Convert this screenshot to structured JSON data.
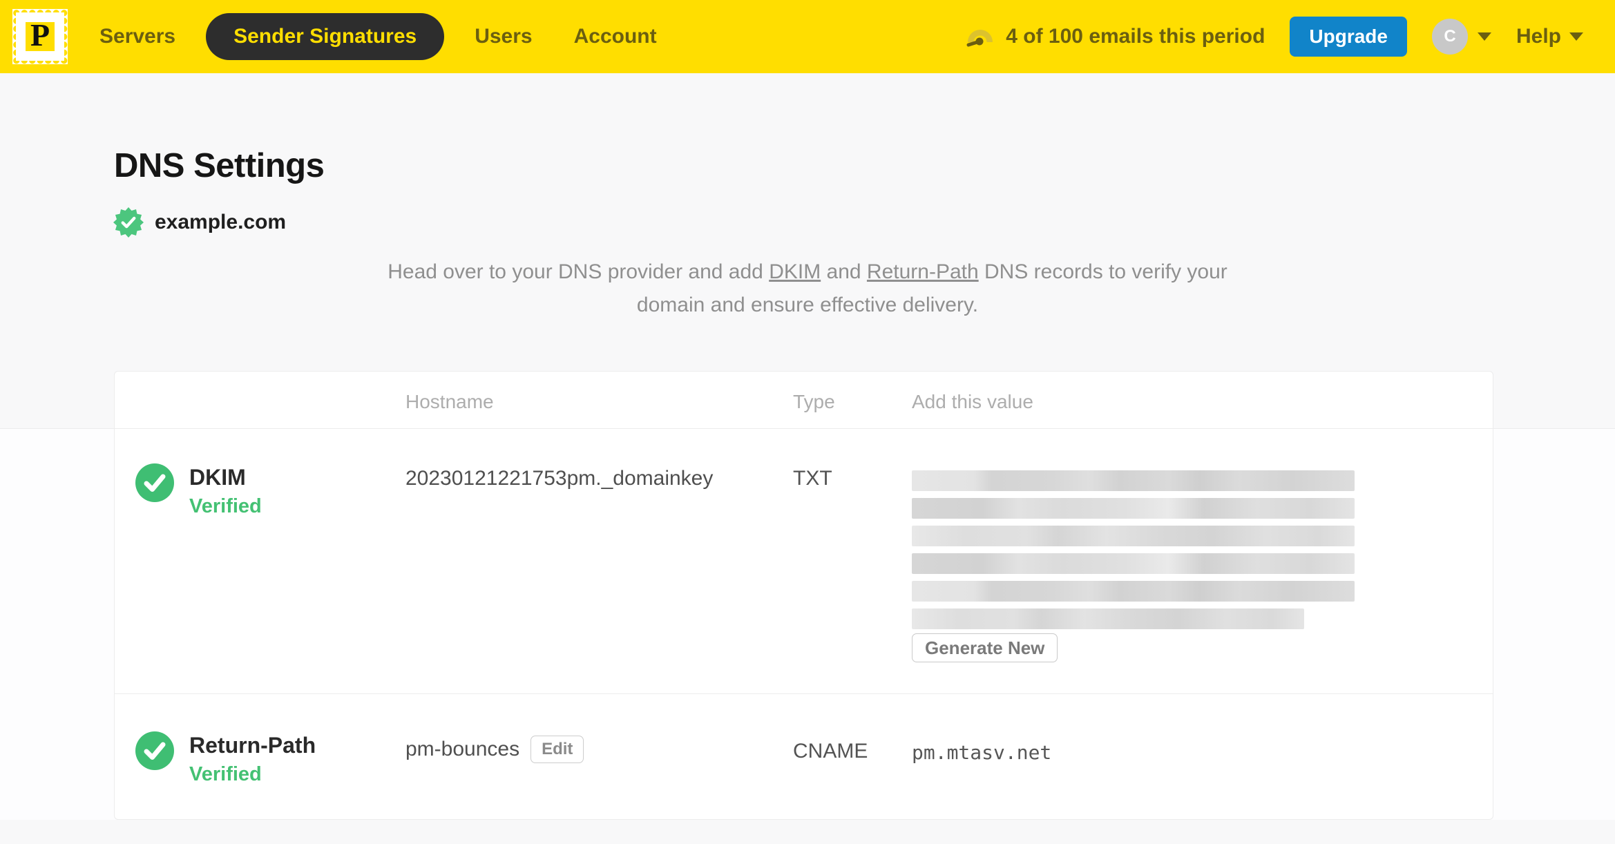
{
  "navbar": {
    "logo_letter": "P",
    "items": [
      {
        "label": "Servers",
        "active": false
      },
      {
        "label": "Sender Signatures",
        "active": true
      },
      {
        "label": "Users",
        "active": false
      },
      {
        "label": "Account",
        "active": false
      }
    ],
    "usage_text": "4 of 100 emails this period",
    "upgrade_label": "Upgrade",
    "avatar_initial": "C",
    "help_label": "Help"
  },
  "page": {
    "title": "DNS Settings",
    "domain": "example.com",
    "domain_status": "verified",
    "description": {
      "before_dkim": "Head over to your DNS provider and add ",
      "dkim_link": "DKIM",
      "and_text": " and ",
      "return_path_link": "Return-Path",
      "after_links": " DNS records to verify your domain and ensure effective delivery."
    }
  },
  "table": {
    "headers": {
      "hostname": "Hostname",
      "type": "Type",
      "value": "Add this value"
    },
    "rows": [
      {
        "name": "DKIM",
        "status": "Verified",
        "hostname": "20230121221753pm._domainkey",
        "type": "TXT",
        "value_redacted": true,
        "action_label": "Generate New"
      },
      {
        "name": "Return-Path",
        "status": "Verified",
        "hostname": "pm-bounces",
        "edit_label": "Edit",
        "type": "CNAME",
        "value": "pm.mtasv.net"
      }
    ]
  },
  "colors": {
    "brand_yellow": "#FFDE00",
    "nav_text_olive": "#6B5F10",
    "active_pill_dark": "#2D2D2D",
    "upgrade_blue": "#1184C9",
    "verified_green": "#3FBE73"
  }
}
